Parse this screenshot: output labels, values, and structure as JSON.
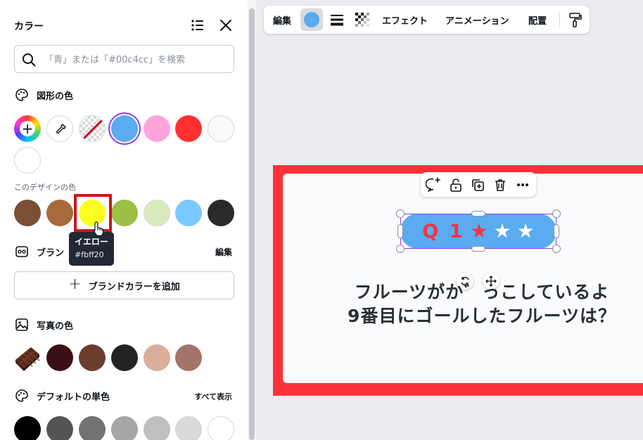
{
  "panel": {
    "title": "カラー",
    "search_placeholder": "「青」または「#00c4cc」を検索",
    "shape_color_label": "図形の色",
    "design_colors_label": "このデザインの色",
    "brand_label": "ブラン",
    "brand_edit": "編集",
    "add_brand_color": "ブランドカラーを追加",
    "photo_colors_label": "写真の色",
    "default_colors_label": "デフォルトの単色",
    "show_all": "すべて表示",
    "shape_swatches": [
      "#5aabf0",
      "#ffa3dc",
      "#ff3131",
      "#f8fafc",
      "#ffffff"
    ],
    "design_swatches": [
      "#7a4f35",
      "#a66a3c",
      "#fbff20",
      "#9cbf45",
      "#d9ebbd",
      "#79c8ff",
      "#2a2a2a"
    ],
    "photo_swatches": [
      "#3a1015",
      "#6a3d2e",
      "#222222",
      "#d9ae9d",
      "#a37468"
    ],
    "default_swatches": [
      "#000000",
      "#545454",
      "#737373",
      "#a6a6a6",
      "#bfbfbf",
      "#d9d9d9",
      "#ffffff"
    ],
    "tooltip": {
      "name": "イエロー",
      "hex": "#fbff20"
    }
  },
  "toolbar": {
    "edit": "編集",
    "effects": "エフェクト",
    "animation": "アニメーション",
    "position": "配置",
    "current_color": "#5aabf0"
  },
  "canvas": {
    "frame_color": "#fb3237",
    "pill_text": "Q 1",
    "stars": [
      "★",
      "★",
      "★"
    ],
    "question_line1": "フルーツがか゛っこしているよ",
    "question_line2": "9番目にゴールしたフルーツは？"
  }
}
